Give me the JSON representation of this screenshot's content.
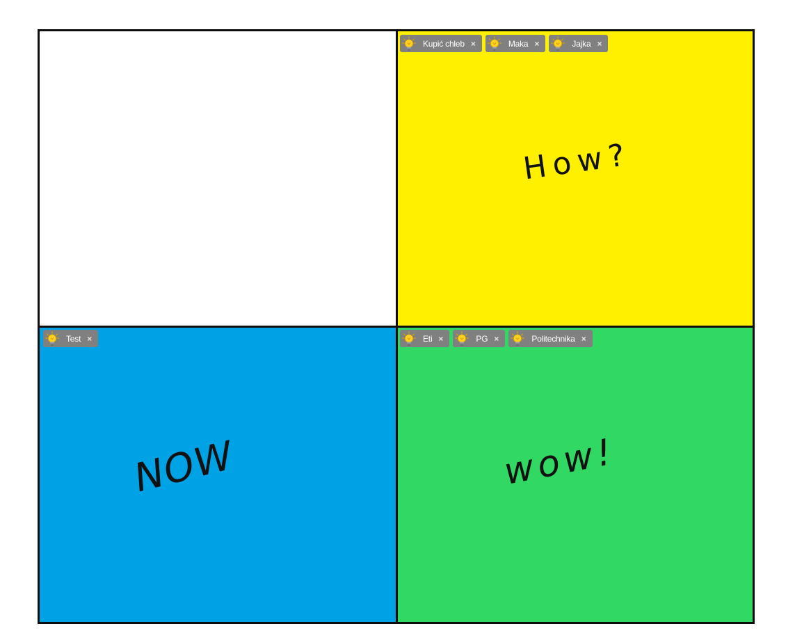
{
  "colors": {
    "top_left": "#ffffff",
    "top_right": "#fff000",
    "bottom_left": "#00a2e6",
    "bottom_right": "#31d863",
    "border": "#0d0d0d",
    "tag_bg": "#808080",
    "tag_text": "#ffffff"
  },
  "close_symbol": "×",
  "tag_icon": "lightbulb-icon",
  "quadrants": {
    "top_left": {
      "tags": [],
      "text": ""
    },
    "top_right": {
      "tags": [
        {
          "label": "Kupić chleb"
        },
        {
          "label": "Maka"
        },
        {
          "label": "Jajka"
        }
      ],
      "text": "How?"
    },
    "bottom_left": {
      "tags": [
        {
          "label": "Test"
        }
      ],
      "text": "NOW"
    },
    "bottom_right": {
      "tags": [
        {
          "label": "Eti"
        },
        {
          "label": "PG"
        },
        {
          "label": "Politechnika"
        }
      ],
      "text": "wow!"
    }
  }
}
